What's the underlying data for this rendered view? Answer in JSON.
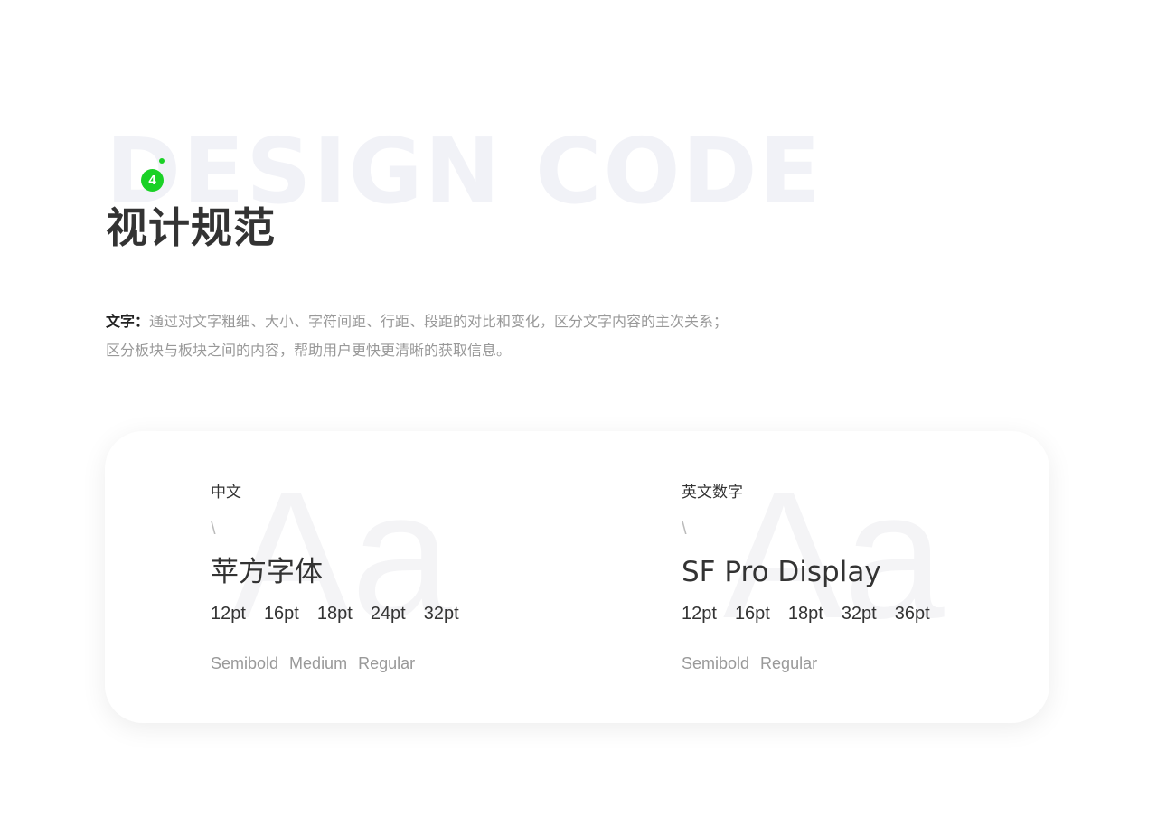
{
  "header": {
    "bg_title": "DESIGN CODE",
    "badge_number": "4",
    "title": "视计规范"
  },
  "description": {
    "label": "文字：",
    "line1": "通过对文字粗细、大小、字符间距、行距、段距的对比和变化，区分文字内容的主次关系；",
    "line2": "区分板块与板块之间的内容，帮助用户更快更清晰的获取信息。"
  },
  "card": {
    "chinese": {
      "bg_glyph": "Aa",
      "label": "中文",
      "slash": "\\",
      "font_name": "苹方字体",
      "sizes": [
        "12pt",
        "16pt",
        "18pt",
        "24pt",
        "32pt"
      ],
      "weights": [
        "Semibold",
        "Medium",
        "Regular"
      ]
    },
    "english": {
      "bg_glyph": "Aa",
      "label": "英文数字",
      "slash": "\\",
      "font_name": "SF Pro Display",
      "sizes": [
        "12pt",
        "16pt",
        "18pt",
        "32pt",
        "36pt"
      ],
      "weights": [
        "Semibold",
        "Regular"
      ]
    }
  },
  "colors": {
    "accent": "#1ad126",
    "text_dark": "#333333",
    "text_muted": "#999999",
    "watermark": "#f1f2f7"
  }
}
